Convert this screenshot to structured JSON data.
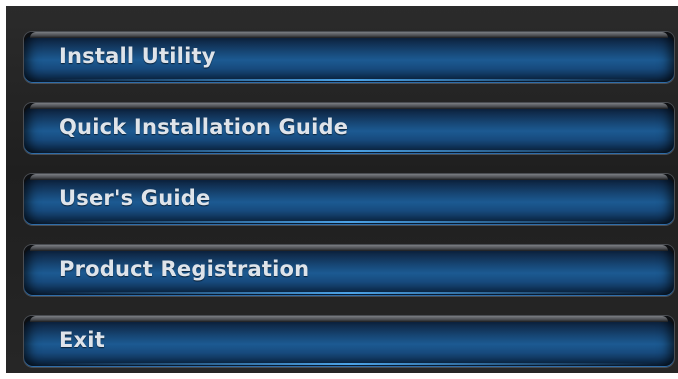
{
  "menu": {
    "items": [
      {
        "label": "Install Utility"
      },
      {
        "label": "Quick Installation Guide"
      },
      {
        "label": "User's Guide"
      },
      {
        "label": "Product Registration"
      },
      {
        "label": "Exit"
      }
    ]
  },
  "colors": {
    "panel_background": "#252525",
    "button_blue": "#1c5a92",
    "label_text": "#dfe4ea"
  }
}
